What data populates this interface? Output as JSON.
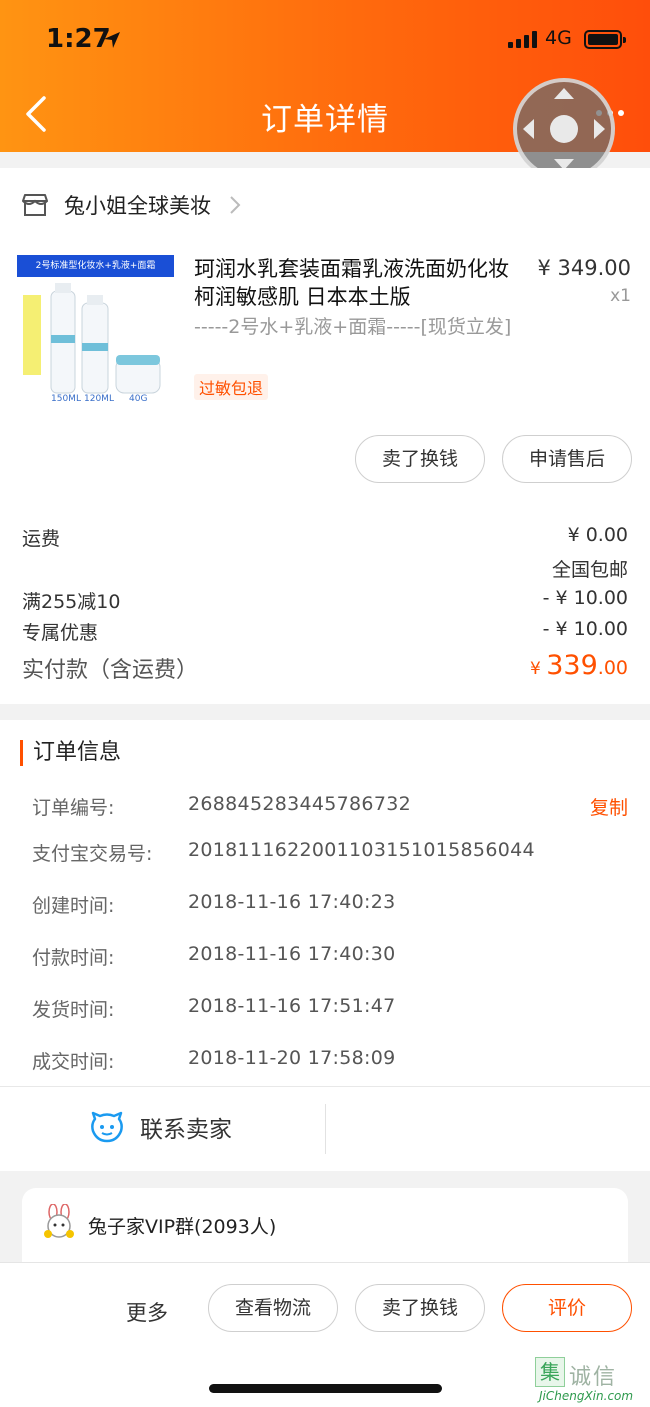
{
  "status_bar": {
    "time": "1:27",
    "network": "4G"
  },
  "nav": {
    "title": "订单详情"
  },
  "shop": {
    "name": "兔小姐全球美妆"
  },
  "product": {
    "image_banner": "2号标准型化妆水+乳液+面霜",
    "title": "珂润水乳套装面霜乳液洗面奶化妆柯润敏感肌  日本本土版",
    "sku": "-----2号水+乳液+面霜-----[现货立发]",
    "tag": "过敏包退",
    "price": "¥ 349.00",
    "qty": "x1",
    "image_sizes": [
      "150ML",
      "120ML",
      "40G"
    ]
  },
  "item_actions": {
    "sell_label": "卖了换钱",
    "after_sale_label": "申请售后"
  },
  "fees": {
    "shipping_label": "运费",
    "shipping_value": "¥ 0.00",
    "shipping_note": "全国包邮",
    "discount1_label": "满255减10",
    "discount1_value": "- ¥ 10.00",
    "discount2_label": "专属优惠",
    "discount2_value": "- ¥ 10.00",
    "paid_label": "实付款（含运费）",
    "paid_currency": "¥ ",
    "paid_integer": "339",
    "paid_decimal": ".00"
  },
  "order_info": {
    "heading": "订单信息",
    "copy_label": "复制",
    "rows": [
      {
        "label": "订单编号:",
        "value": "268845283445786732"
      },
      {
        "label": "支付宝交易号:",
        "value": "2018111622001103151015856044"
      },
      {
        "label": "创建时间:",
        "value": "2018-11-16 17:40:23"
      },
      {
        "label": "付款时间:",
        "value": "2018-11-16 17:40:30"
      },
      {
        "label": "发货时间:",
        "value": "2018-11-16 17:51:47"
      },
      {
        "label": "成交时间:",
        "value": "2018-11-20 17:58:09"
      }
    ]
  },
  "contact": {
    "label": "联系卖家"
  },
  "group": {
    "name": "兔子家VIP群(2093人)"
  },
  "bottom": {
    "more_label": "更多",
    "logistics_label": "查看物流",
    "sell_label": "卖了换钱",
    "review_label": "评价"
  },
  "watermark": {
    "char": "集",
    "text": "诚信",
    "url": "JiChengXin.com"
  },
  "colors": {
    "accent": "#ff5000",
    "header_start": "#ff9412",
    "header_end": "#ff4e0b",
    "contact_blue": "#1a9af0"
  }
}
